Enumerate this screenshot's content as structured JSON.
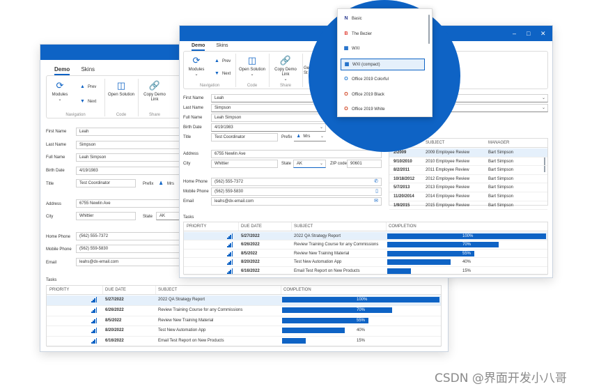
{
  "ribbon": {
    "tabs": [
      "Demo",
      "Skins"
    ],
    "modules": "Modules",
    "prev": "Prev",
    "next": "Next",
    "open_solution": "Open Solution",
    "copy_demo_link_back": "Copy Demo Link",
    "copy_demo_link_front": "Copy Demo Link",
    "group_navigation": "Navigation",
    "group_code": "Code",
    "group_share": "Share",
    "truncated_front_1": "Ge",
    "truncated_front_2": "St"
  },
  "form": {
    "labels": {
      "first_name": "First Name",
      "last_name": "Last Name",
      "full_name": "Full Name",
      "birth_date": "Birth Date",
      "title": "Title",
      "prefix": "Prefix",
      "address": "Address",
      "city": "City",
      "state": "State",
      "zip": "ZIP code",
      "home_phone": "Home Phone",
      "mobile_phone": "Mobile Phone",
      "email": "Email",
      "tasks": "Tasks"
    },
    "values": {
      "first_name": "Leah",
      "last_name": "Simpson",
      "full_name": "Leah Simpson",
      "birth_date": "4/19/1983",
      "title": "Test Coordinator",
      "prefix": "Mrs",
      "address": "6755 Newlin Ave",
      "city": "Whittier",
      "state": "AK",
      "zip": "90601",
      "home_phone": "(562) 555-7372",
      "mobile_phone": "(562) 559-5830",
      "email": "leahs@dx-email.com"
    }
  },
  "tasks": {
    "columns": [
      "PRIORITY",
      "DUE DATE",
      "SUBJECT",
      "COMPLETION"
    ],
    "rows": [
      {
        "due": "5/27/2022",
        "subject": "2022 QA Strategy Report",
        "completion_pct": 100,
        "completion": "100%"
      },
      {
        "due": "6/26/2022",
        "subject": "Review Training Course for any Commissions",
        "completion_pct": 70,
        "completion": "70%"
      },
      {
        "due": "8/5/2022",
        "subject": "Review New Training Material",
        "completion_pct": 55,
        "completion": "55%"
      },
      {
        "due": "8/20/2022",
        "subject": "Test New Automation App",
        "completion_pct": 40,
        "completion": "40%"
      },
      {
        "due": "6/16/2022",
        "subject": "Email Test Report on New Products",
        "completion_pct": 15,
        "completion": "15%"
      }
    ]
  },
  "reviews": {
    "columns": [
      "SUBJECT",
      "MANAGER"
    ],
    "rows": [
      {
        "date": "2/2009",
        "subject": "2009 Employee Review",
        "manager": "Bart Simpson"
      },
      {
        "date": "9/10/2010",
        "subject": "2010 Employee Review",
        "manager": "Bart Simpson"
      },
      {
        "date": "8/2/2011",
        "subject": "2011 Employee Review",
        "manager": "Bart Simpson"
      },
      {
        "date": "10/18/2012",
        "subject": "2012 Employee Review",
        "manager": "Bart Simpson"
      },
      {
        "date": "5/7/2013",
        "subject": "2013 Employee Review",
        "manager": "Bart Simpson"
      },
      {
        "date": "11/20/2014",
        "subject": "2014 Employee Review",
        "manager": "Bart Simpson"
      },
      {
        "date": "1/9/2015",
        "subject": "2015 Employee Review",
        "manager": "Bart Simpson"
      }
    ]
  },
  "skins": {
    "items": [
      {
        "label": "Basic",
        "icon": "bezier-basic-icon",
        "color": "#2b3a8f"
      },
      {
        "label": "The Bezier",
        "icon": "bezier-icon",
        "color": "#e03a2f"
      },
      {
        "label": "WXI",
        "icon": "windows-icon",
        "color": "#0e63c5"
      },
      {
        "label": "WXI (compact)",
        "icon": "windows-icon",
        "color": "#0e63c5"
      },
      {
        "label": "Office 2019 Colorful",
        "icon": "office-icon",
        "color": "#2a7fd4"
      },
      {
        "label": "Office 2019 Black",
        "icon": "office-icon",
        "color": "#d04423"
      },
      {
        "label": "Office 2019 White",
        "icon": "office-icon",
        "color": "#d04423"
      }
    ],
    "selected": "WXI (compact)"
  },
  "watermark": "CSDN @界面开发小八哥",
  "colors": {
    "accent": "#0e63c5",
    "selection": "#e5f0fb"
  }
}
